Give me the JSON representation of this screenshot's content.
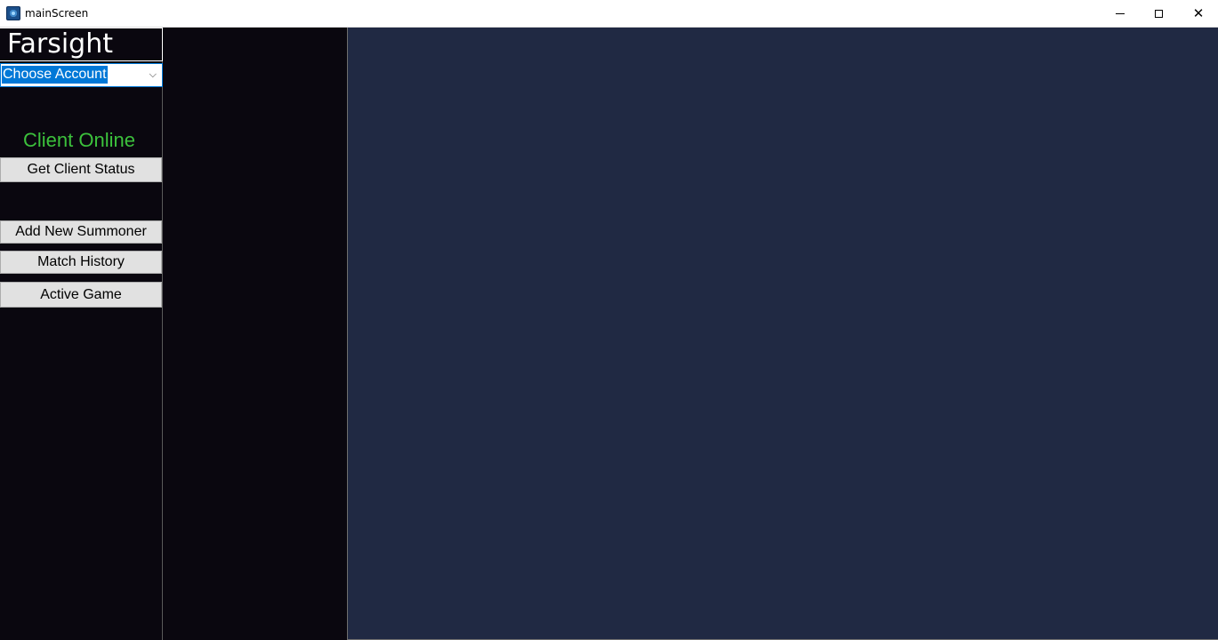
{
  "window": {
    "title": "mainScreen",
    "close_glyph": "✕"
  },
  "sidebar": {
    "brand": "Farsight",
    "account_select": {
      "selected": "Choose Account",
      "chevron": "⌵"
    },
    "client_status": "Client Online",
    "buttons": {
      "get_client_status": "Get Client Status",
      "add_new_summoner": "Add New Summoner",
      "match_history": "Match History",
      "active_game": "Active Game"
    }
  },
  "colors": {
    "sidebar_bg": "#0a070f",
    "main_panel_bg": "#202943",
    "status_online": "#3cc13c",
    "selection": "#0078d7"
  }
}
